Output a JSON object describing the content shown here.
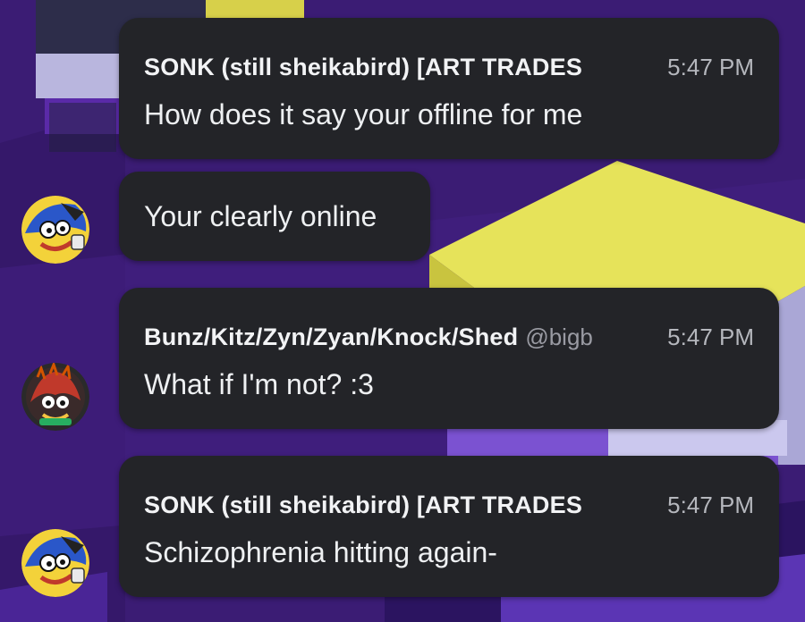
{
  "messages": [
    {
      "author": "SONK (still sheikabird) [ART TRADES",
      "handle": "",
      "time": "5:47 PM",
      "text": "How does it say your offline for me",
      "avatar_icon": "sonic-character-avatar"
    },
    {
      "text": "Your clearly online",
      "avatar_icon": "sonic-character-avatar"
    },
    {
      "author": "Bunz/Kitz/Zyn/Zyan/Knock/Shed",
      "handle": "@bigb",
      "time": "5:47 PM",
      "text": "What if I'm not? :3",
      "avatar_icon": "knuckles-character-avatar"
    },
    {
      "author": "SONK (still sheikabird) [ART TRADES",
      "handle": "",
      "time": "5:47 PM",
      "text": "Schizophrenia hitting again-",
      "avatar_icon": "sonic-character-avatar"
    }
  ],
  "colors": {
    "bubble": "#232428",
    "background": "#3f1f7a",
    "name_text": "#f2f3f5",
    "time_text": "#b5b7bd",
    "handle_text": "#9a9ba3"
  }
}
